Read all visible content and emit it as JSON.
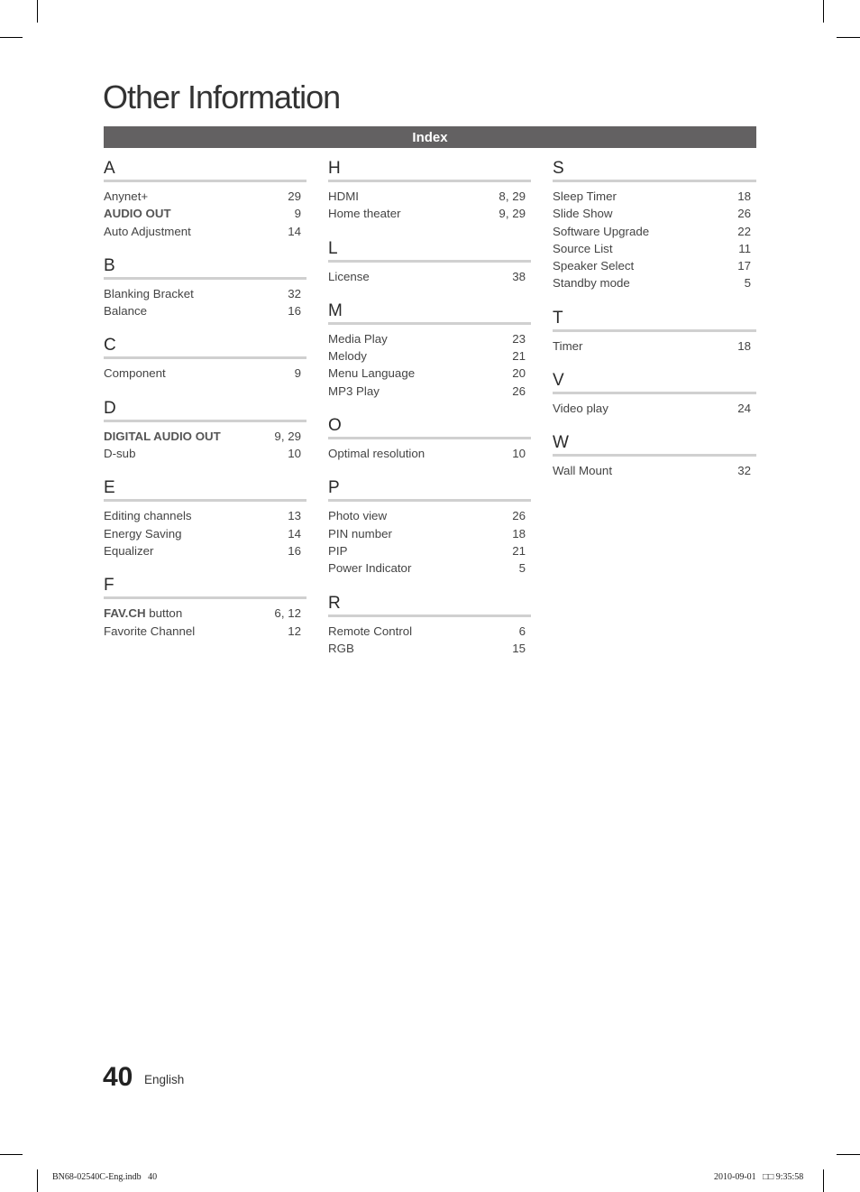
{
  "page": {
    "title": "Other Information",
    "section_header": "Index",
    "page_number": "40",
    "language": "English",
    "slug_left": "BN68-02540C-Eng.indb   40",
    "slug_right": "2010-09-01   □□ 9:35:58"
  },
  "columns": [
    {
      "sections": [
        {
          "letter": "A",
          "entries": [
            {
              "term": "Anynet+",
              "bold": "",
              "pages": "29"
            },
            {
              "term": "",
              "bold": "AUDIO OUT",
              "pages": "9"
            },
            {
              "term": "Auto Adjustment",
              "bold": "",
              "pages": "14"
            }
          ]
        },
        {
          "letter": "B",
          "entries": [
            {
              "term": "Blanking Bracket",
              "bold": "",
              "pages": "32"
            },
            {
              "term": "Balance",
              "bold": "",
              "pages": "16"
            }
          ]
        },
        {
          "letter": "C",
          "entries": [
            {
              "term": "Component",
              "bold": "",
              "pages": "9"
            }
          ]
        },
        {
          "letter": "D",
          "entries": [
            {
              "term": "",
              "bold": "DIGITAL AUDIO OUT",
              "pages": "9, 29"
            },
            {
              "term": "D-sub",
              "bold": "",
              "pages": "10"
            }
          ]
        },
        {
          "letter": "E",
          "entries": [
            {
              "term": "Editing channels",
              "bold": "",
              "pages": "13"
            },
            {
              "term": "Energy Saving",
              "bold": "",
              "pages": "14"
            },
            {
              "term": "Equalizer",
              "bold": "",
              "pages": "16"
            }
          ]
        },
        {
          "letter": "F",
          "entries": [
            {
              "term": " button",
              "bold": "FAV.CH",
              "pages": "6, 12"
            },
            {
              "term": "Favorite Channel",
              "bold": "",
              "pages": "12"
            }
          ]
        }
      ]
    },
    {
      "sections": [
        {
          "letter": "H",
          "entries": [
            {
              "term": "HDMI",
              "bold": "",
              "pages": "8, 29"
            },
            {
              "term": "Home theater",
              "bold": "",
              "pages": "9, 29"
            }
          ]
        },
        {
          "letter": "L",
          "entries": [
            {
              "term": "License",
              "bold": "",
              "pages": "38"
            }
          ]
        },
        {
          "letter": "M",
          "entries": [
            {
              "term": "Media Play",
              "bold": "",
              "pages": "23"
            },
            {
              "term": "Melody",
              "bold": "",
              "pages": "21"
            },
            {
              "term": "Menu Language",
              "bold": "",
              "pages": "20"
            },
            {
              "term": "MP3 Play",
              "bold": "",
              "pages": "26"
            }
          ]
        },
        {
          "letter": "O",
          "entries": [
            {
              "term": "Optimal resolution",
              "bold": "",
              "pages": "10"
            }
          ]
        },
        {
          "letter": "P",
          "entries": [
            {
              "term": "Photo view",
              "bold": "",
              "pages": "26"
            },
            {
              "term": "PIN number",
              "bold": "",
              "pages": "18"
            },
            {
              "term": "PIP",
              "bold": "",
              "pages": "21"
            },
            {
              "term": "Power Indicator",
              "bold": "",
              "pages": "5"
            }
          ]
        },
        {
          "letter": "R",
          "entries": [
            {
              "term": "Remote Control",
              "bold": "",
              "pages": "6"
            },
            {
              "term": "RGB",
              "bold": "",
              "pages": "15"
            }
          ]
        }
      ]
    },
    {
      "sections": [
        {
          "letter": "S",
          "entries": [
            {
              "term": "Sleep Timer",
              "bold": "",
              "pages": "18"
            },
            {
              "term": "Slide Show",
              "bold": "",
              "pages": "26"
            },
            {
              "term": "Software Upgrade",
              "bold": "",
              "pages": "22"
            },
            {
              "term": "Source List",
              "bold": "",
              "pages": "11"
            },
            {
              "term": "Speaker Select",
              "bold": "",
              "pages": "17"
            },
            {
              "term": "Standby mode",
              "bold": "",
              "pages": "5"
            }
          ]
        },
        {
          "letter": "T",
          "entries": [
            {
              "term": "Timer",
              "bold": "",
              "pages": "18"
            }
          ]
        },
        {
          "letter": "V",
          "entries": [
            {
              "term": "Video play",
              "bold": "",
              "pages": "24"
            }
          ]
        },
        {
          "letter": "W",
          "entries": [
            {
              "term": "Wall Mount",
              "bold": "",
              "pages": "32"
            }
          ]
        }
      ]
    }
  ],
  "colors": {
    "header_bar": "#636162",
    "rule": "#d0d0d0",
    "text": "#444444"
  }
}
